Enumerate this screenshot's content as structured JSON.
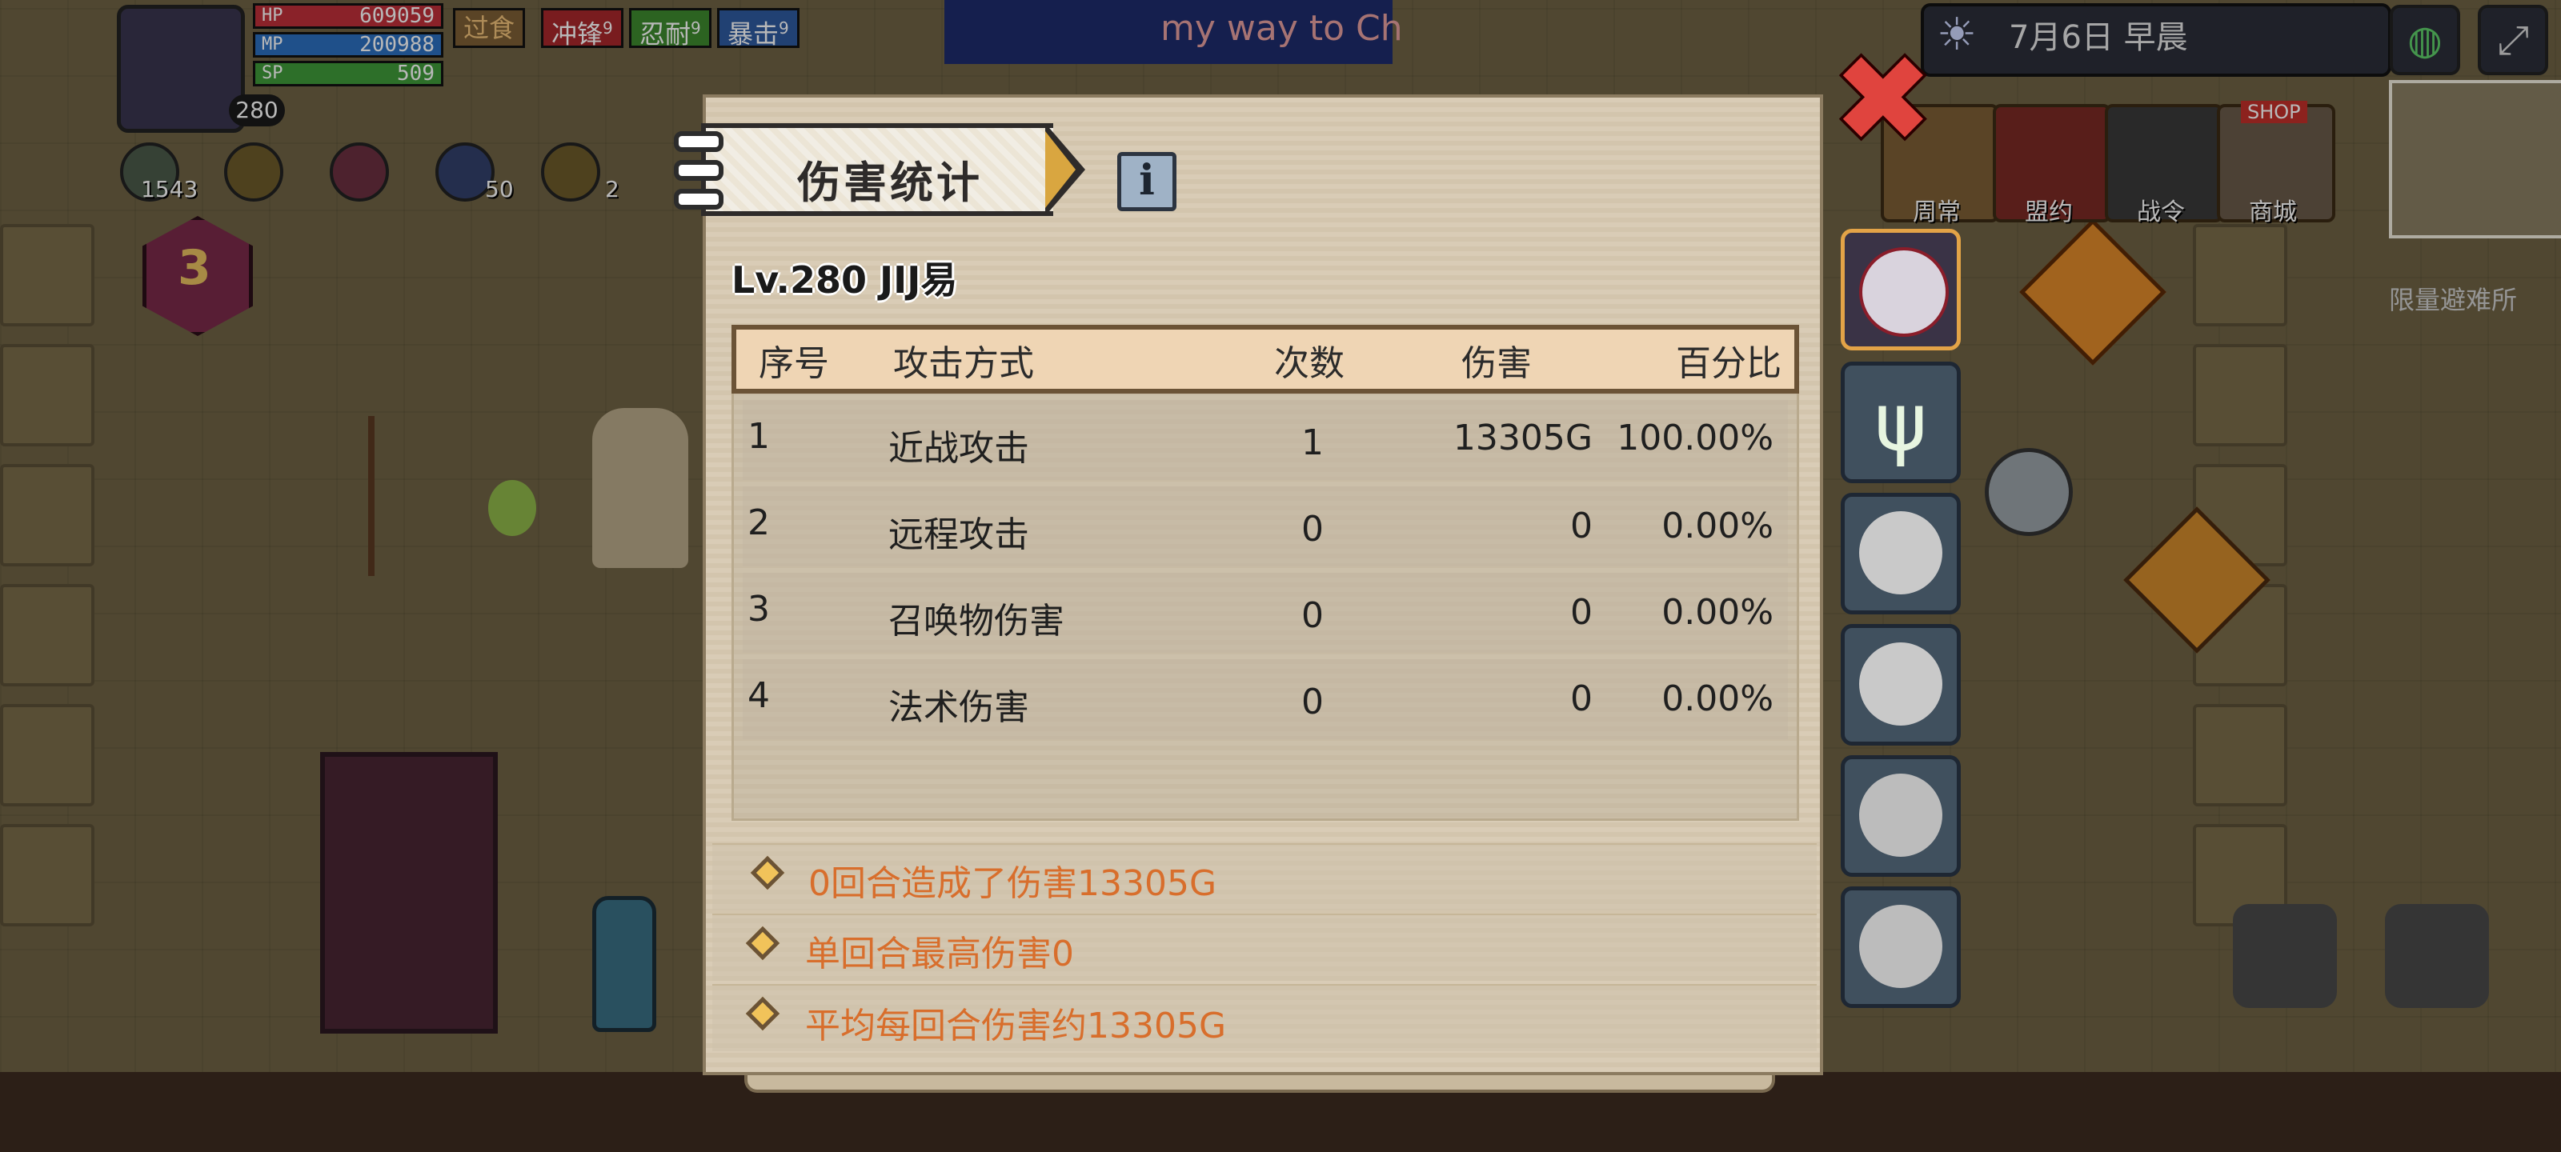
{
  "hud": {
    "level_badge": "280",
    "hp_label": "HP",
    "hp_value": "609059",
    "mp_label": "MP",
    "mp_value": "200988",
    "sp_label": "SP",
    "sp_value": "509",
    "buffs": [
      {
        "label": "过食",
        "count": ""
      },
      {
        "label": "冲锋",
        "count": "9"
      },
      {
        "label": "忍耐",
        "count": "9"
      },
      {
        "label": "暴击",
        "count": "9"
      }
    ],
    "resources": [
      "1543",
      "",
      "",
      "50",
      "2"
    ],
    "floor_badge": "3",
    "date_text": "7月6日 早晨",
    "marquee": "my way to Ch",
    "top_menu": [
      "周常",
      "盟约",
      "战令",
      "商城"
    ],
    "shop_sign": "SHOP",
    "minimap_label": "限量避难所"
  },
  "dialog": {
    "title": "伤害统计",
    "info_label": "i",
    "close_label": "✖",
    "player": "Lv.280  JIJ易",
    "columns": [
      "序号",
      "攻击方式",
      "次数",
      "伤害",
      "百分比"
    ],
    "rows": [
      {
        "idx": "1",
        "type": "近战攻击",
        "count": "1",
        "damage": "13305G",
        "percent": "100.00%"
      },
      {
        "idx": "2",
        "type": "远程攻击",
        "count": "0",
        "damage": "0",
        "percent": "0.00%"
      },
      {
        "idx": "3",
        "type": "召唤物伤害",
        "count": "0",
        "damage": "0",
        "percent": "0.00%"
      },
      {
        "idx": "4",
        "type": "法术伤害",
        "count": "0",
        "damage": "0",
        "percent": "0.00%"
      }
    ],
    "stats": [
      "0回合造成了伤害13305G",
      "单回合最高伤害0",
      "平均每回合伤害约13305G"
    ]
  },
  "side_tabs": [
    "player-portrait",
    "antler-spirit",
    "nurse-1",
    "nurse-2",
    "maid-1",
    "maid-2"
  ],
  "colors": {
    "accent": "#d86e2c",
    "close": "#e0443e",
    "active_tab": "#e3a347"
  }
}
